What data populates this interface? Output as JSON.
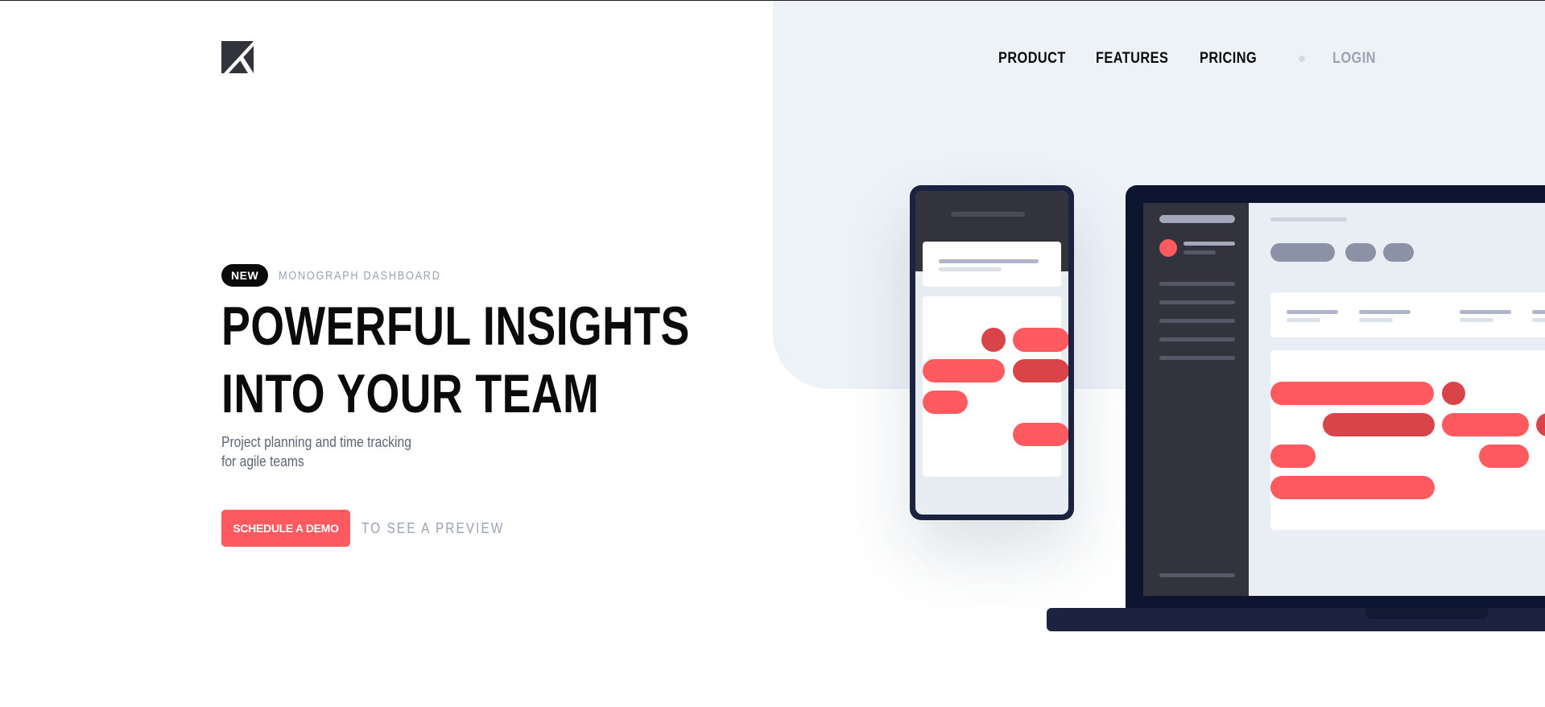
{
  "brand": {
    "logo_icon": "monograph-logo-icon"
  },
  "nav": {
    "items": [
      "PRODUCT",
      "FEATURES",
      "PRICING"
    ],
    "login": "LOGIN"
  },
  "hero": {
    "badge": "NEW",
    "badge_label": "MONOGRAPH DASHBOARD",
    "headline": "POWERFUL INSIGHTS INTO YOUR TEAM",
    "subline_line1": "Project planning and time tracking",
    "subline_line2": "for agile teams",
    "cta": "SCHEDULE A DEMO",
    "cta_aside": "TO SEE A PREVIEW"
  },
  "colors": {
    "accent": "#ff5a5f",
    "accent_dark": "#d84448",
    "text": "#0b0b0b",
    "muted": "#9aa3b2",
    "panel": "#edf2f6",
    "device": "#1c2340",
    "sidebar": "#32333c"
  }
}
